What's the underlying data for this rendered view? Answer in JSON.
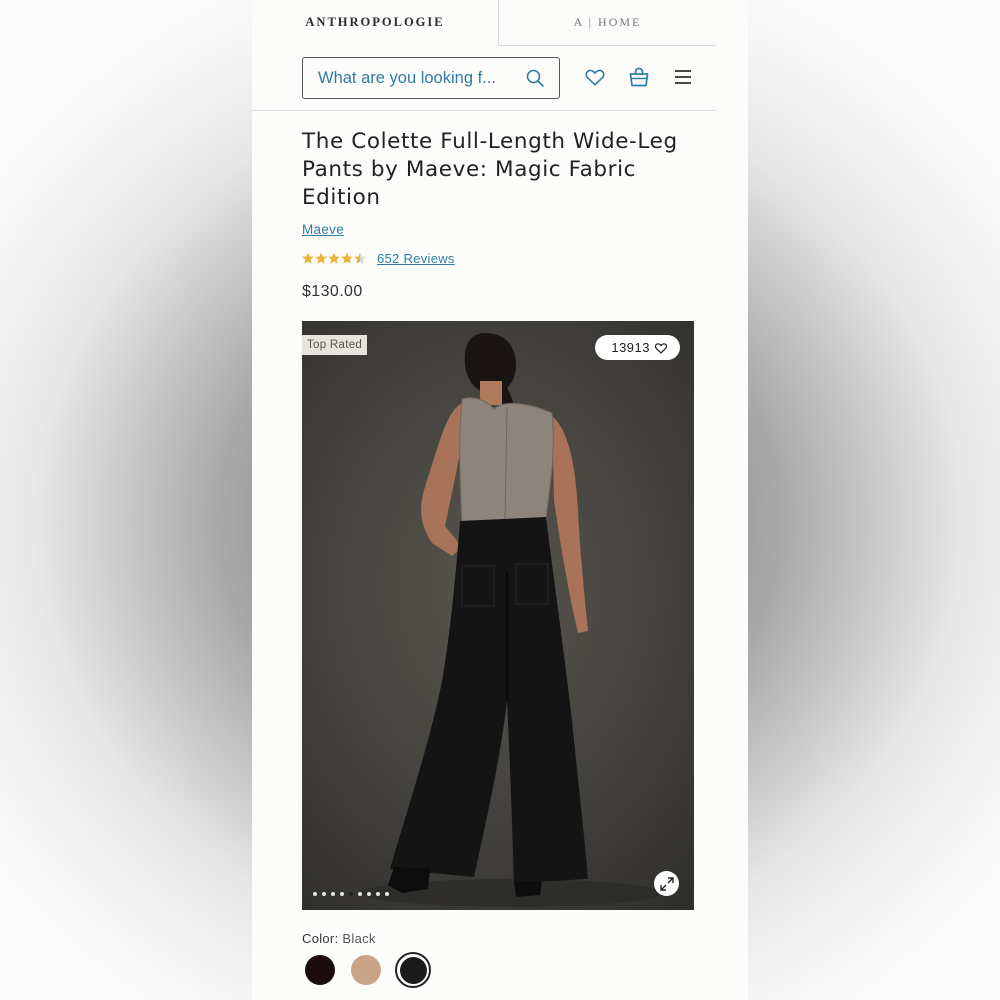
{
  "header": {
    "brand_tab": "ANTHROPOLOGIE",
    "home_tab": "A | HOME"
  },
  "search": {
    "placeholder": "What are you looking f..."
  },
  "icons": {
    "search": "search-icon",
    "wishlist": "heart-icon",
    "bag": "shopping-bag-icon",
    "menu": "hamburger-menu-icon"
  },
  "product": {
    "title": "The Colette Full-Length Wide-Leg Pants by Maeve: Magic Fabric Edition",
    "brand": "Maeve",
    "rating": 4.5,
    "reviews_label": "652 Reviews",
    "price": "$130.00"
  },
  "gallery": {
    "badge": "Top Rated",
    "likes": "13913",
    "image_count": 9,
    "active_index": 4
  },
  "color": {
    "label": "Color:",
    "selected": "Black",
    "swatches": [
      {
        "name": "Burgundy",
        "hex": "#1d0c0c"
      },
      {
        "name": "Tan",
        "hex": "#c9a487"
      },
      {
        "name": "Black",
        "hex": "#1b1b1b",
        "selected": true
      }
    ]
  },
  "colors": {
    "link": "#2e7da1",
    "star": "#e8b33a"
  }
}
